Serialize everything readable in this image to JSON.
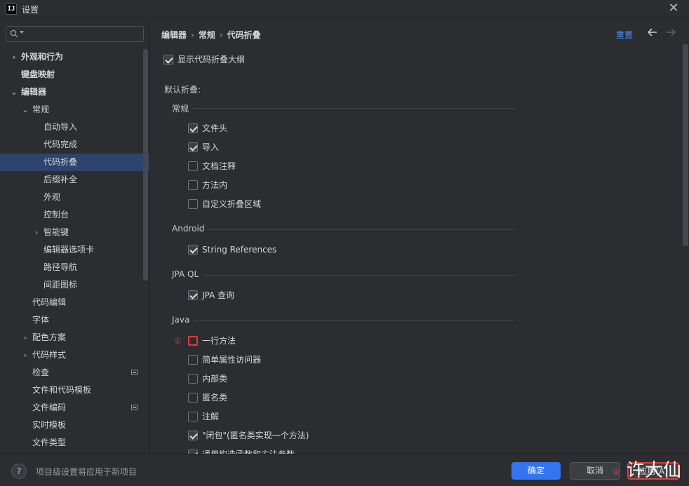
{
  "window": {
    "app_logo": "IJ",
    "title": "设置"
  },
  "sidebar": {
    "search_placeholder": "",
    "items": [
      {
        "label": "外观和行为",
        "bold": true,
        "arrow": "›",
        "indent": 0
      },
      {
        "label": "键盘映射",
        "bold": true,
        "arrow": "",
        "indent": 0
      },
      {
        "label": "编辑器",
        "bold": true,
        "arrow": "⌄",
        "indent": 0
      },
      {
        "label": "常规",
        "bold": false,
        "arrow": "⌄",
        "indent": 1
      },
      {
        "label": "自动导入",
        "bold": false,
        "arrow": "",
        "indent": 2
      },
      {
        "label": "代码完成",
        "bold": false,
        "arrow": "",
        "indent": 2
      },
      {
        "label": "代码折叠",
        "bold": false,
        "arrow": "",
        "indent": 2,
        "selected": true
      },
      {
        "label": "后缀补全",
        "bold": false,
        "arrow": "",
        "indent": 2
      },
      {
        "label": "外观",
        "bold": false,
        "arrow": "",
        "indent": 2
      },
      {
        "label": "控制台",
        "bold": false,
        "arrow": "",
        "indent": 2
      },
      {
        "label": "智能键",
        "bold": false,
        "arrow": "›",
        "indent": 2
      },
      {
        "label": "编辑器选项卡",
        "bold": false,
        "arrow": "",
        "indent": 2
      },
      {
        "label": "路径导航",
        "bold": false,
        "arrow": "",
        "indent": 2
      },
      {
        "label": "间距图标",
        "bold": false,
        "arrow": "",
        "indent": 2
      },
      {
        "label": "代码编辑",
        "bold": false,
        "arrow": "",
        "indent": 1
      },
      {
        "label": "字体",
        "bold": false,
        "arrow": "",
        "indent": 1
      },
      {
        "label": "配色方案",
        "bold": false,
        "arrow": "›",
        "indent": 1
      },
      {
        "label": "代码样式",
        "bold": false,
        "arrow": "›",
        "indent": 1
      },
      {
        "label": "检查",
        "bold": false,
        "arrow": "",
        "indent": 1,
        "badge": true
      },
      {
        "label": "文件和代码模板",
        "bold": false,
        "arrow": "",
        "indent": 1
      },
      {
        "label": "文件编码",
        "bold": false,
        "arrow": "",
        "indent": 1,
        "badge": true
      },
      {
        "label": "实时模板",
        "bold": false,
        "arrow": "",
        "indent": 1
      },
      {
        "label": "文件类型",
        "bold": false,
        "arrow": "",
        "indent": 1
      }
    ]
  },
  "header": {
    "breadcrumb": [
      "编辑器",
      "常规",
      "代码折叠"
    ],
    "reset_label": "重置"
  },
  "content": {
    "show_outline": {
      "label": "显示代码折叠大纲",
      "checked": true
    },
    "default_fold_label": "默认折叠:",
    "groups": [
      {
        "title": "常规",
        "options": [
          {
            "label": "文件头",
            "checked": true
          },
          {
            "label": "导入",
            "checked": true
          },
          {
            "label": "文档注释",
            "checked": false
          },
          {
            "label": "方法内",
            "checked": false
          },
          {
            "label": "自定义折叠区域",
            "checked": false
          }
        ]
      },
      {
        "title": "Android",
        "options": [
          {
            "label": "String References",
            "checked": true
          }
        ]
      },
      {
        "title": "JPA QL",
        "options": [
          {
            "label": "JPA 查询",
            "checked": true
          }
        ]
      },
      {
        "title": "Java",
        "options": [
          {
            "label": "一行方法",
            "checked": false,
            "highlight": true
          },
          {
            "label": "简单属性访问器",
            "checked": false
          },
          {
            "label": "内部类",
            "checked": false
          },
          {
            "label": "匿名类",
            "checked": false
          },
          {
            "label": "注解",
            "checked": false
          },
          {
            "label": "\"闭包\"(匿名类实现一个方法)",
            "checked": true
          },
          {
            "label": "通用构造函数和方法参数",
            "checked": true
          }
        ]
      }
    ],
    "annotation_1": "①"
  },
  "footer": {
    "help_label": "?",
    "hint": "项目级设置将应用于新项目",
    "ok_label": "确定",
    "cancel_label": "取消",
    "apply_label": "应用(A)",
    "annotation_2": "②",
    "watermark": "许大仙"
  },
  "colors": {
    "background": "#2b2d30",
    "selection": "#2e436e",
    "accent": "#3574f0",
    "link": "#548af7",
    "annotation": "#e23a3a"
  }
}
